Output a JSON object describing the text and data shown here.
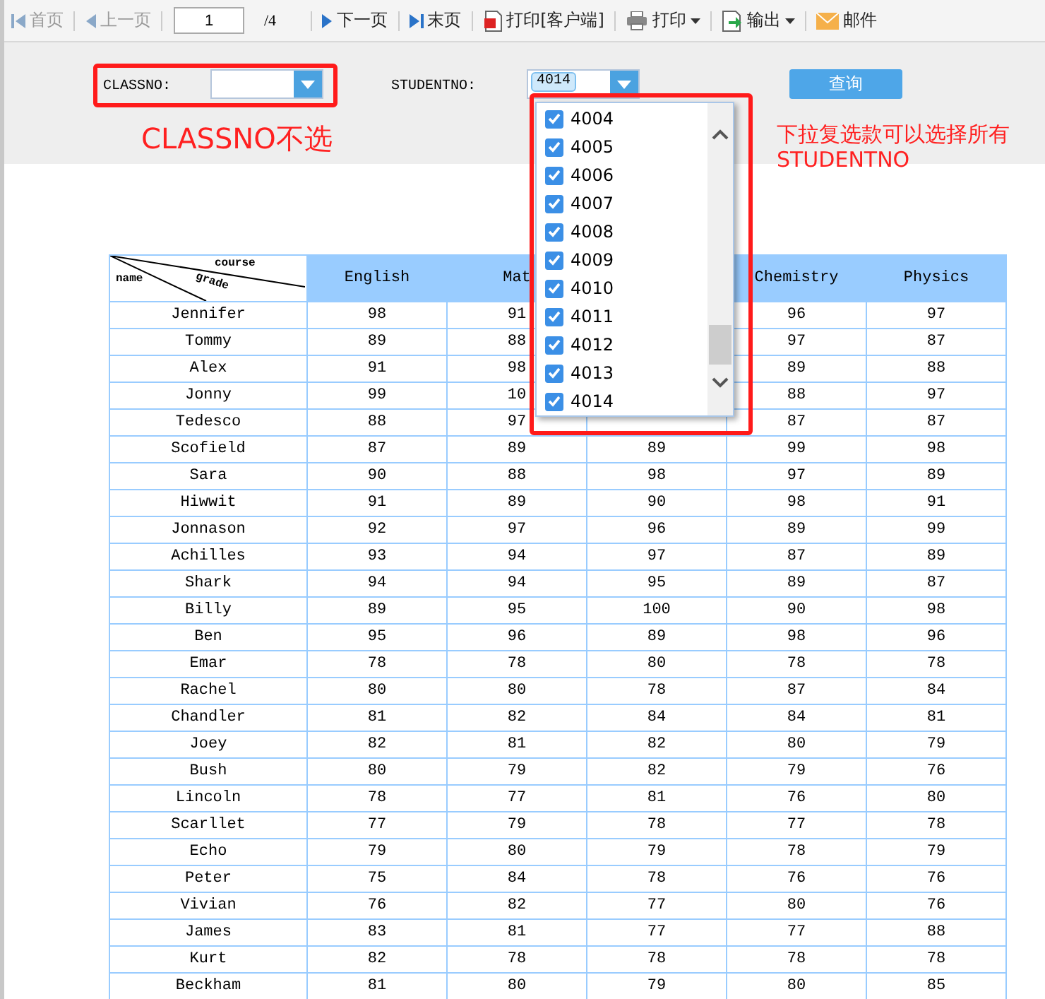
{
  "toolbar": {
    "items": [
      {
        "kind": "first",
        "label": "首页",
        "disabled": true
      },
      {
        "kind": "prev",
        "label": "上一页",
        "disabled": true
      },
      {
        "kind": "pageinput",
        "label": "1"
      },
      {
        "kind": "pagetotal",
        "label": "/4"
      },
      {
        "kind": "next",
        "label": "下一页",
        "disabled": false
      },
      {
        "kind": "last",
        "label": "末页",
        "disabled": false
      },
      {
        "kind": "pdf",
        "label": "打印[客户端]",
        "disabled": false
      },
      {
        "kind": "print",
        "label": "打印",
        "disabled": false,
        "menu": true
      },
      {
        "kind": "export",
        "label": "输出",
        "disabled": false,
        "menu": true
      },
      {
        "kind": "mail",
        "label": "邮件",
        "disabled": false
      }
    ]
  },
  "filters": {
    "classno": {
      "label": "CLASSNO:"
    },
    "studentno": {
      "label": "STUDENTNO:",
      "tags": [
        "4014"
      ]
    },
    "query_button": "查询"
  },
  "dropdown": {
    "options": [
      {
        "label": "4004",
        "checked": true
      },
      {
        "label": "4005",
        "checked": true
      },
      {
        "label": "4006",
        "checked": true
      },
      {
        "label": "4007",
        "checked": true
      },
      {
        "label": "4008",
        "checked": true
      },
      {
        "label": "4009",
        "checked": true
      },
      {
        "label": "4010",
        "checked": true
      },
      {
        "label": "4011",
        "checked": true
      },
      {
        "label": "4012",
        "checked": true
      },
      {
        "label": "4013",
        "checked": true
      },
      {
        "label": "4014",
        "checked": true
      }
    ]
  },
  "annotations": [
    {
      "lines": [
        "CLASSNO不选"
      ]
    },
    {
      "lines": [
        "下拉复选款可以选择所有",
        "STUDENTNO"
      ]
    }
  ],
  "table": {
    "corner": {
      "course": "course",
      "grade": "grade",
      "name": "name"
    },
    "columns": {
      "english": "English",
      "math": "Mat",
      "chemistry": "Chemistry",
      "physics": "Physics"
    },
    "rows": [
      {
        "name": "Jennifer",
        "english": "98",
        "math": "91",
        "chemistry": "96",
        "physics": "97"
      },
      {
        "name": "Tommy",
        "english": "89",
        "math": "88",
        "chemistry": "97",
        "physics": "87"
      },
      {
        "name": "Alex",
        "english": "91",
        "math": "98",
        "chemistry": "89",
        "physics": "88"
      },
      {
        "name": "Jonny",
        "english": "99",
        "math": "10",
        "chemistry": "88",
        "physics": "97"
      },
      {
        "name": "Tedesco",
        "english": "88",
        "math": "97",
        "chemistry": "87",
        "physics": "87"
      },
      {
        "name": "Scofield",
        "scores": [
          "87",
          "89",
          "89",
          "99",
          "98"
        ]
      },
      {
        "name": "Sara",
        "scores": [
          "90",
          "88",
          "98",
          "97",
          "89"
        ]
      },
      {
        "name": "Hiwwit",
        "scores": [
          "91",
          "89",
          "90",
          "98",
          "91"
        ]
      },
      {
        "name": "Jonnason",
        "scores": [
          "92",
          "97",
          "96",
          "89",
          "99"
        ]
      },
      {
        "name": "Achilles",
        "scores": [
          "93",
          "94",
          "97",
          "87",
          "89"
        ]
      },
      {
        "name": "Shark",
        "scores": [
          "94",
          "94",
          "95",
          "89",
          "87"
        ]
      },
      {
        "name": "Billy",
        "scores": [
          "89",
          "95",
          "100",
          "90",
          "98"
        ]
      },
      {
        "name": "Ben",
        "scores": [
          "95",
          "96",
          "89",
          "98",
          "96"
        ]
      },
      {
        "name": "Emar",
        "scores": [
          "78",
          "78",
          "80",
          "78",
          "78"
        ]
      },
      {
        "name": "Rachel",
        "scores": [
          "80",
          "80",
          "78",
          "87",
          "84"
        ]
      },
      {
        "name": "Chandler",
        "scores": [
          "81",
          "82",
          "84",
          "84",
          "81"
        ]
      },
      {
        "name": "Joey",
        "scores": [
          "82",
          "81",
          "82",
          "80",
          "79"
        ]
      },
      {
        "name": "Bush",
        "scores": [
          "80",
          "79",
          "82",
          "79",
          "76"
        ]
      },
      {
        "name": "Lincoln",
        "scores": [
          "78",
          "77",
          "81",
          "76",
          "80"
        ]
      },
      {
        "name": "Scarllet",
        "scores": [
          "77",
          "79",
          "78",
          "77",
          "78"
        ]
      },
      {
        "name": "Echo",
        "scores": [
          "79",
          "80",
          "79",
          "78",
          "79"
        ]
      },
      {
        "name": "Peter",
        "scores": [
          "75",
          "84",
          "78",
          "76",
          "76"
        ]
      },
      {
        "name": "Vivian",
        "scores": [
          "76",
          "82",
          "77",
          "80",
          "76"
        ]
      },
      {
        "name": "James",
        "scores": [
          "83",
          "81",
          "77",
          "77",
          "88"
        ]
      },
      {
        "name": "Kurt",
        "scores": [
          "82",
          "78",
          "78",
          "78",
          "78"
        ]
      },
      {
        "name": "Beckham",
        "scores": [
          "81",
          "80",
          "79",
          "80",
          "85"
        ]
      }
    ]
  }
}
